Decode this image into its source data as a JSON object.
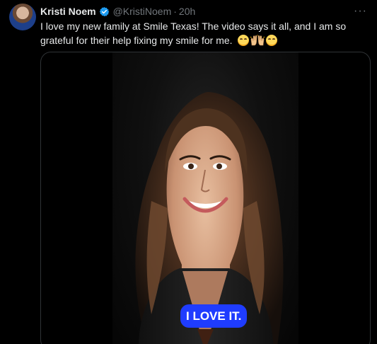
{
  "tweet": {
    "display_name": "Kristi Noem",
    "handle": "@KristiNoem",
    "separator": "·",
    "time": "20h",
    "more_label": "···",
    "text": "I love my new family at Smile Texas! The video says it all, and I am so grateful for their help fixing my smile for me.",
    "verified_color": "#1d9bf0",
    "emoji_names": [
      "smiling-face-icon",
      "raising-hands-icon",
      "smiling-face-icon"
    ]
  },
  "media": {
    "type": "video",
    "caption": "I LOVE IT.",
    "caption_color": "#1f3cff"
  },
  "colors": {
    "background": "#000000",
    "text_primary": "#e7e9ea",
    "text_secondary": "#71767b",
    "border": "#2f3336"
  }
}
